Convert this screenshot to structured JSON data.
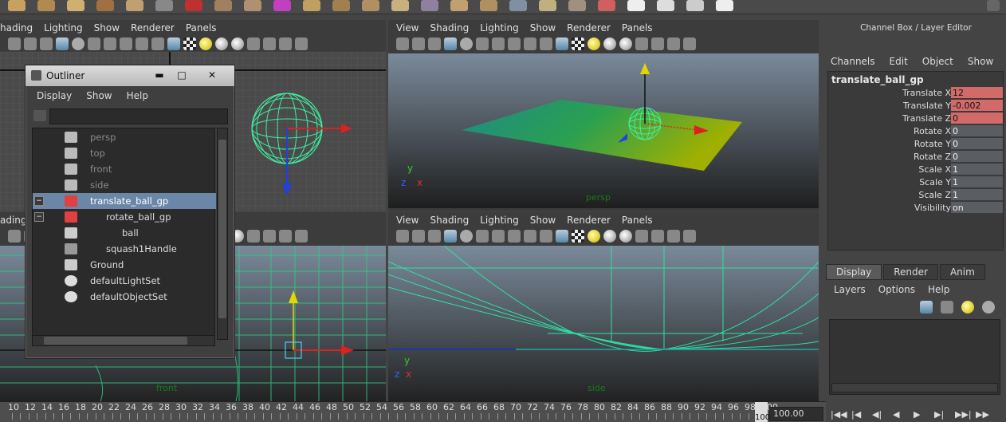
{
  "viewport_menu": [
    "View",
    "Shading",
    "Lighting",
    "Show",
    "Renderer",
    "Panels"
  ],
  "left_vp_menu": [
    "hading",
    "Lighting",
    "Show",
    "Renderer",
    "Panels"
  ],
  "left_vp_menu2": [
    "ading"
  ],
  "persp_label": "persp",
  "side_label": "side",
  "front_label": "front",
  "axis": {
    "x": "x",
    "y": "y",
    "z": "z"
  },
  "outliner": {
    "title": "Outliner",
    "min": "▬",
    "max": "□",
    "close": "✕",
    "menu": [
      "Display",
      "Show",
      "Help"
    ],
    "items": [
      {
        "label": "persp",
        "dim": true,
        "indent": 0
      },
      {
        "label": "top",
        "dim": true,
        "indent": 0
      },
      {
        "label": "front",
        "dim": true,
        "indent": 0
      },
      {
        "label": "side",
        "dim": true,
        "indent": 0
      },
      {
        "label": "translate_ball_gp",
        "selected": true,
        "indent": 0,
        "expander": "−"
      },
      {
        "label": "rotate_ball_gp",
        "indent": 1,
        "expander": "−"
      },
      {
        "label": "ball",
        "indent": 2
      },
      {
        "label": "squash1Handle",
        "indent": 1
      },
      {
        "label": "Ground",
        "indent": 0
      },
      {
        "label": "defaultLightSet",
        "indent": 0
      },
      {
        "label": "defaultObjectSet",
        "indent": 0
      }
    ]
  },
  "channel_box": {
    "header": "Channel Box / Layer Editor",
    "menu": [
      "Channels",
      "Edit",
      "Object",
      "Show"
    ],
    "object": "translate_ball_gp",
    "attributes": [
      {
        "name": "Translate X",
        "value": "12",
        "keyed": true
      },
      {
        "name": "Translate Y",
        "value": "-0.002",
        "keyed": true
      },
      {
        "name": "Translate Z",
        "value": "0",
        "keyed": true
      },
      {
        "name": "Rotate X",
        "value": "0",
        "keyed": false
      },
      {
        "name": "Rotate Y",
        "value": "0",
        "keyed": false
      },
      {
        "name": "Rotate Z",
        "value": "0",
        "keyed": false
      },
      {
        "name": "Scale X",
        "value": "1",
        "keyed": false
      },
      {
        "name": "Scale Y",
        "value": "1",
        "keyed": false
      },
      {
        "name": "Scale Z",
        "value": "1",
        "keyed": false
      },
      {
        "name": "Visibility",
        "value": "on",
        "keyed": false
      }
    ]
  },
  "layer_tabs": [
    "Display",
    "Render",
    "Anim"
  ],
  "layer_menu": [
    "Layers",
    "Options",
    "Help"
  ],
  "timeline": {
    "ticks": [
      "10",
      "12",
      "14",
      "16",
      "18",
      "20",
      "22",
      "24",
      "26",
      "28",
      "30",
      "32",
      "34",
      "36",
      "38",
      "40",
      "42",
      "44",
      "46",
      "48",
      "50",
      "52",
      "54",
      "56",
      "58",
      "60",
      "62",
      "64",
      "66",
      "68",
      "70",
      "72",
      "74",
      "76",
      "78",
      "80",
      "82",
      "84",
      "86",
      "88",
      "90",
      "92",
      "94",
      "96",
      "98",
      "100"
    ],
    "end_label": "100",
    "current_frame": "100.00"
  },
  "playback": [
    "|◀◀",
    "|◀",
    "◀|",
    "◀",
    "▶",
    "▶|",
    "▶▶|",
    "▶▶"
  ],
  "colors": {
    "wire": "#3ff0a0",
    "keyed": "#d36a6a",
    "selected": "#6b87a8",
    "bg": "#444444"
  }
}
